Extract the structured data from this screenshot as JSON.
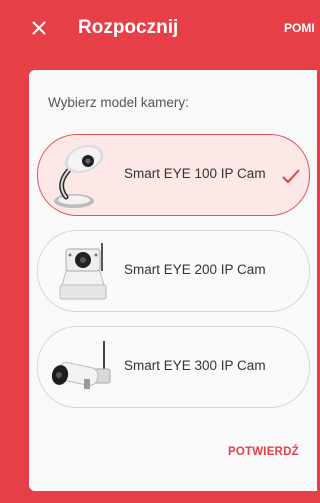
{
  "appbar": {
    "title": "Rozpocznij",
    "skip_label": "POMI",
    "close_icon": "close-icon",
    "background": "#e63f47"
  },
  "card": {
    "prompt": "Wybierz model kamery:",
    "options": [
      {
        "label": "Smart EYE 100 IP Cam",
        "selected": true,
        "icon": "camera-100-image"
      },
      {
        "label": "Smart EYE 200 IP Cam",
        "selected": false,
        "icon": "camera-200-image"
      },
      {
        "label": "Smart EYE 300 IP Cam",
        "selected": false,
        "icon": "camera-300-image"
      }
    ],
    "confirm_label": "POTWIERDŹ",
    "accent": "#e63f47"
  }
}
